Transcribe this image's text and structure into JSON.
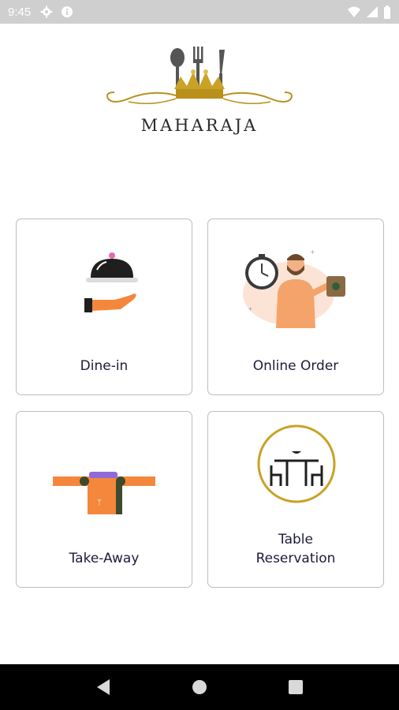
{
  "status_bar": {
    "time": "9:45",
    "left_icons": [
      "settings-icon",
      "info-icon"
    ],
    "right_icons": [
      "wifi-icon",
      "cellular-signal-icon",
      "battery-icon"
    ],
    "color": "#cfcfcf"
  },
  "brand": {
    "name": "MAHARAJA",
    "accent_gold": "#c9a227"
  },
  "tiles": [
    {
      "label": "Dine-in",
      "icon": "cloche-serving-icon"
    },
    {
      "label": "Online Order",
      "icon": "delivery-man-clock-icon"
    },
    {
      "label": "Take-Away",
      "icon": "takeaway-bag-icon"
    },
    {
      "label_line1": "Table",
      "label_line2": "Reservation",
      "icon": "dining-table-icon"
    }
  ],
  "nav_bar": {
    "buttons": [
      "back-icon",
      "home-icon",
      "recents-icon"
    ]
  }
}
